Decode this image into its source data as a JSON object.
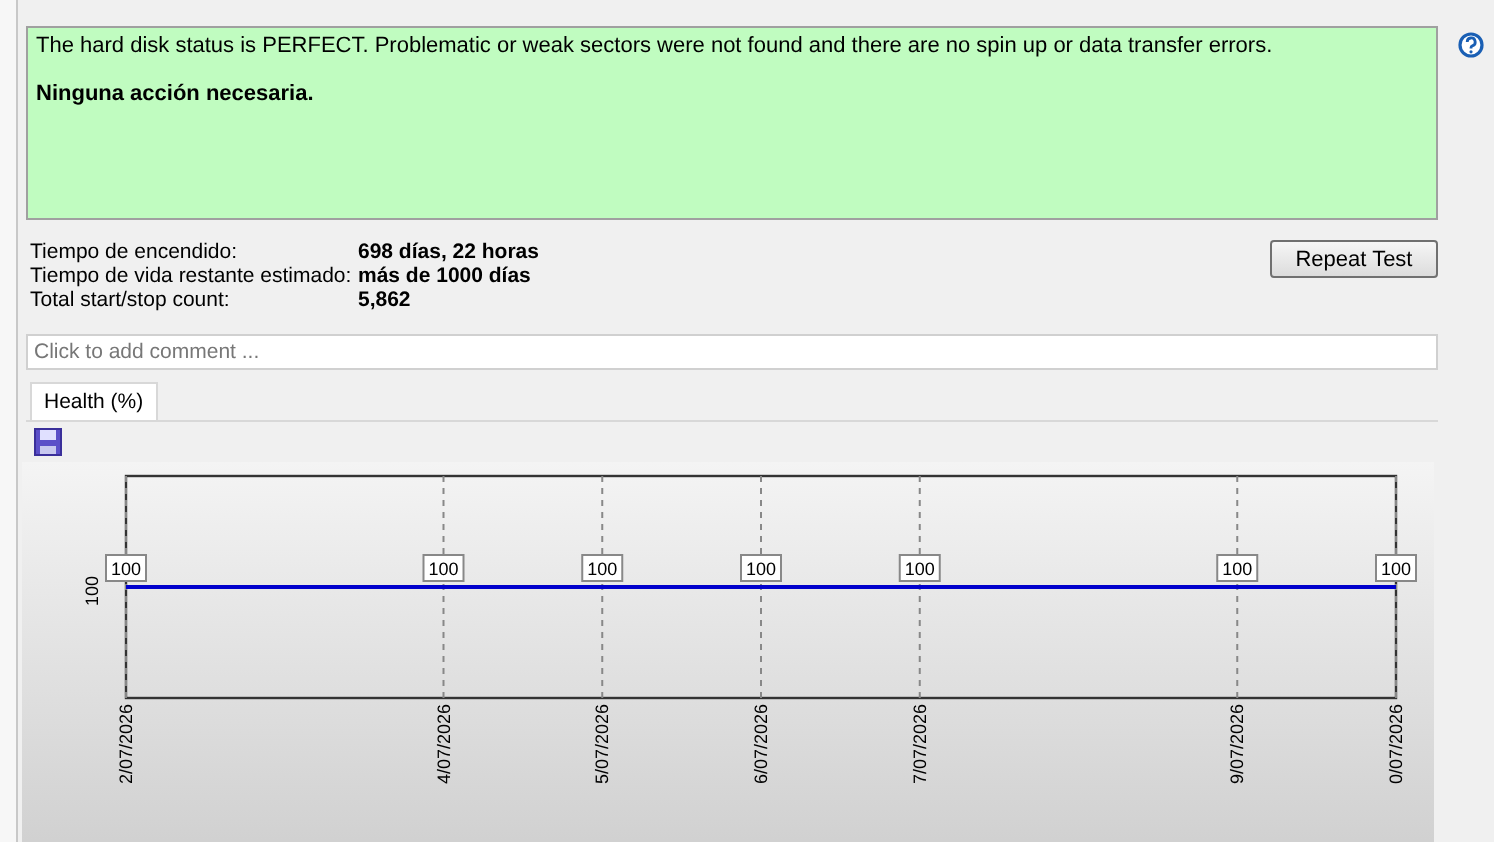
{
  "status_message": {
    "text": "The hard disk status is PERFECT. Problematic or weak sectors were not found and there are no spin up or data transfer errors.",
    "action": "Ninguna acción necesaria."
  },
  "info": [
    {
      "label": "Tiempo de encendido:",
      "value": "698 días, 22 horas"
    },
    {
      "label": "Tiempo de vida restante estimado:",
      "value": "más de 1000 días"
    },
    {
      "label": "Total start/stop count:",
      "value": "5,862"
    }
  ],
  "repeat_button": "Repeat Test",
  "comment": {
    "placeholder": "Click to add comment ..."
  },
  "tabs": [
    {
      "label": "Health (%)",
      "selected": true
    }
  ],
  "health_chart": {
    "y_label": "100",
    "points": [
      {
        "date": "2/07/2026",
        "label": "100"
      },
      {
        "date": "4/07/2026",
        "label": "100"
      },
      {
        "date": "5/07/2026",
        "label": "100"
      },
      {
        "date": "6/07/2026",
        "label": "100"
      },
      {
        "date": "7/07/2026",
        "label": "100"
      },
      {
        "date": "9/07/2026",
        "label": "100"
      },
      {
        "date": "0/07/2026",
        "label": "100"
      }
    ]
  }
}
